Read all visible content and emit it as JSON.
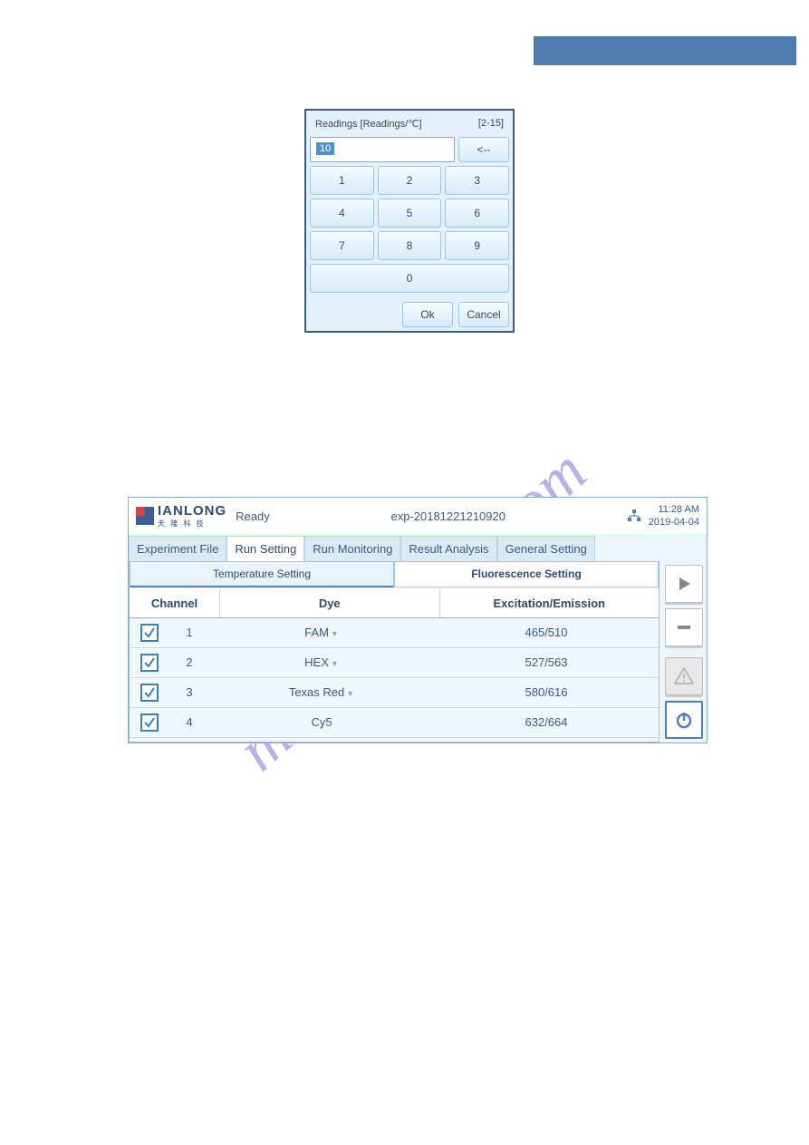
{
  "readingsPanel": {
    "title": "Readings  [Readings/℃]",
    "range": "[2-15]",
    "value": "10",
    "backspace": "<--",
    "keypad": [
      "1",
      "2",
      "3",
      "4",
      "5",
      "6",
      "7",
      "8",
      "9"
    ],
    "zero": "0",
    "ok": "Ok",
    "cancel": "Cancel"
  },
  "watermark": "manualshive.com",
  "app": {
    "logoText": "IANLONG",
    "logoCn": "天 隆 科 技",
    "status": "Ready",
    "expName": "exp-20181221210920",
    "time": "11:28 AM",
    "date": "2019-04-04",
    "tabs": [
      "Experiment File",
      "Run Setting",
      "Run Monitoring",
      "Result Analysis",
      "General Setting"
    ],
    "activeTab": 1,
    "subtabs": {
      "temp": "Temperature Setting",
      "fluor": "Fluorescence Setting"
    },
    "tableHeader": {
      "channel": "Channel",
      "dye": "Dye",
      "ee": "Excitation/Emission"
    },
    "rows": [
      {
        "checked": true,
        "ch": "1",
        "dye": "FAM",
        "ee": "465/510",
        "dropdown": true
      },
      {
        "checked": true,
        "ch": "2",
        "dye": "HEX",
        "ee": "527/563",
        "dropdown": true
      },
      {
        "checked": true,
        "ch": "3",
        "dye": "Texas Red",
        "ee": "580/616",
        "dropdown": true
      },
      {
        "checked": true,
        "ch": "4",
        "dye": "Cy5",
        "ee": "632/664",
        "dropdown": false
      }
    ]
  }
}
